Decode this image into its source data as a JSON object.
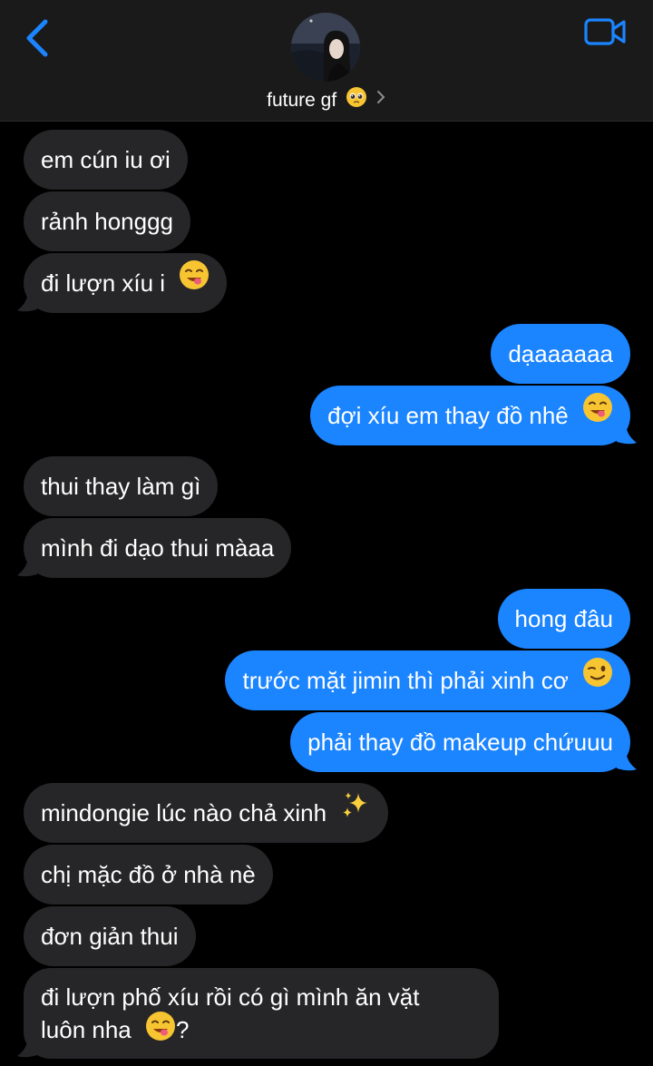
{
  "header": {
    "contact_name": "future gf",
    "name_emoji": "pleading-face-emoji"
  },
  "colors": {
    "accent_blue": "#1b84ff",
    "incoming_bubble": "#262628",
    "header_bg": "#1a1a1a",
    "background": "#000000"
  },
  "messages": [
    {
      "dir": "in",
      "text": "em cún iu ơi"
    },
    {
      "dir": "in",
      "text": "rảnh honggg"
    },
    {
      "dir": "in",
      "text": "đi lượn xíu i",
      "emoji": "yum-face-emoji"
    },
    {
      "dir": "out",
      "text": "dạaaaaaa"
    },
    {
      "dir": "out",
      "text": "đợi xíu em thay đồ nhê",
      "emoji": "yum-face-emoji"
    },
    {
      "dir": "in",
      "text": "thui thay làm gì"
    },
    {
      "dir": "in",
      "text": "mình đi dạo thui màaa"
    },
    {
      "dir": "out",
      "text": "hong đâu"
    },
    {
      "dir": "out",
      "text": "trước mặt jimin thì phải xinh cơ",
      "emoji": "winking-face-emoji"
    },
    {
      "dir": "out",
      "text": "phải thay đồ makeup chứuuu"
    },
    {
      "dir": "in",
      "text": "mindongie lúc nào chả xinh",
      "emoji": "sparkles-emoji"
    },
    {
      "dir": "in",
      "text": "chị mặc đồ ở nhà nè"
    },
    {
      "dir": "in",
      "text": "đơn giản thui"
    },
    {
      "dir": "in",
      "line1": "đi lượn phố xíu rồi có gì mình ăn vặt",
      "line2": "luôn nha",
      "line2_suffix": "?",
      "emoji": "yum-face-emoji"
    }
  ]
}
